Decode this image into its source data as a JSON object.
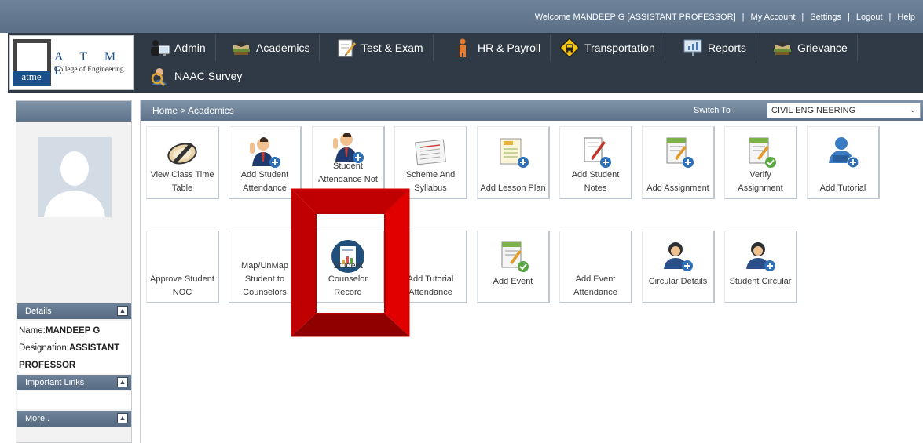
{
  "topbar": {
    "welcome": "Welcome MANDEEP G [ASSISTANT PROFESSOR]",
    "links": [
      "My Account",
      "Settings",
      "Logout",
      "Help"
    ]
  },
  "logo": {
    "letters": "A T M E",
    "tag": "atme",
    "college": "College of Engineering"
  },
  "nav": [
    {
      "label": "Admin",
      "icon": "admin-icon"
    },
    {
      "label": "Academics",
      "icon": "academics-icon"
    },
    {
      "label": "Test & Exam",
      "icon": "test-exam-icon"
    },
    {
      "label": "HR & Payroll",
      "icon": "hr-payroll-icon"
    },
    {
      "label": "Transportation",
      "icon": "transportation-icon"
    },
    {
      "label": "Reports",
      "icon": "reports-icon"
    },
    {
      "label": "Grievance",
      "icon": "grievance-icon"
    },
    {
      "label": "NAAC Survey",
      "icon": "naac-survey-icon"
    }
  ],
  "breadcrumb": "Home > Academics",
  "switch_to": {
    "label": "Switch To :",
    "value": "CIVIL ENGINEERING"
  },
  "left": {
    "details_title": "Details",
    "name_label": "Name:",
    "name_value": "MANDEEP G",
    "designation_label": "Designation:",
    "designation_value": "ASSISTANT PROFESSOR",
    "important_links_title": "Important Links",
    "more_title": "More.."
  },
  "tiles": [
    {
      "label": "View Class Time Table",
      "icon": "clock-pencil-icon"
    },
    {
      "label": "Add Student Attendance",
      "icon": "student-add-icon"
    },
    {
      "label": "Student Attendance Not Added",
      "icon": "student-add-icon"
    },
    {
      "label": "Scheme And Syllabus",
      "icon": "syllabus-icon"
    },
    {
      "label": "Add Lesson Plan",
      "icon": "lesson-plan-icon"
    },
    {
      "label": "Add Student Notes",
      "icon": "notes-icon"
    },
    {
      "label": "Add Assignment",
      "icon": "assignment-icon"
    },
    {
      "label": "Verify Assignment",
      "icon": "verify-assignment-icon"
    },
    {
      "label": "Add Tutorial",
      "icon": "tutorial-icon"
    },
    {
      "label": "Approve Student NOC",
      "icon": ""
    },
    {
      "label": "Map/UnMap Student to Counselors",
      "icon": ""
    },
    {
      "label": "Student Counselor Record",
      "icon": "counselor-record-icon"
    },
    {
      "label": "Add Tutorial Attendance",
      "icon": ""
    },
    {
      "label": "Add Event",
      "icon": "event-icon"
    },
    {
      "label": "Add Event Attendance",
      "icon": ""
    },
    {
      "label": "Circular Details",
      "icon": "circular-user-icon"
    },
    {
      "label": "Student Circular",
      "icon": "circular-user-icon"
    }
  ],
  "colors": {
    "topbar": "#5b6f86",
    "header": "#2f3a46",
    "highlight": "#cc0000"
  }
}
